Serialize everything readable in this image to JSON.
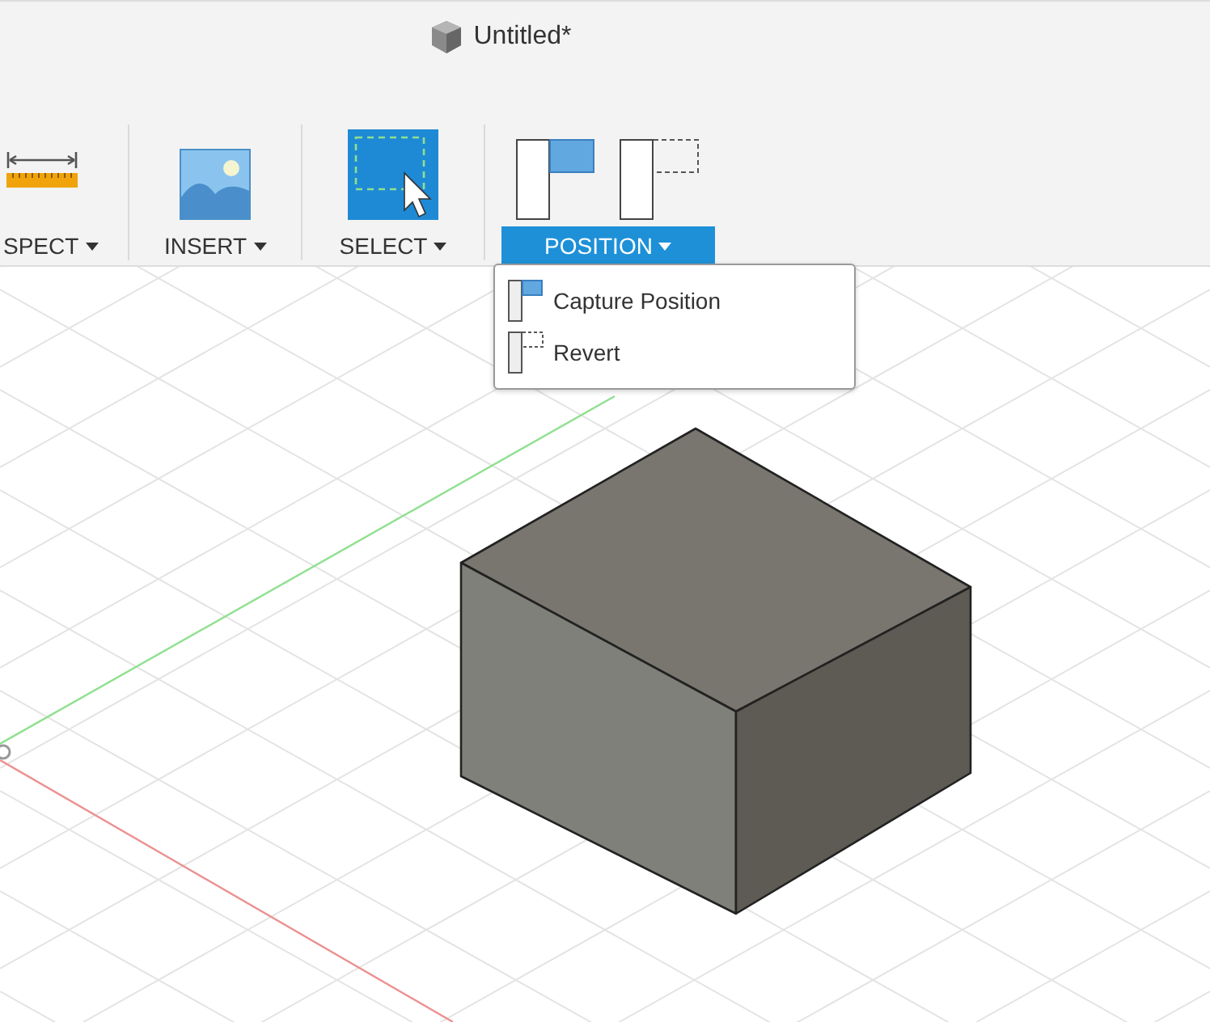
{
  "window": {
    "title": "Untitled*"
  },
  "toolbar": {
    "groups": [
      {
        "label": "SPECT",
        "kind": "inspect",
        "selected": false
      },
      {
        "label": "INSERT",
        "kind": "insert",
        "selected": false
      },
      {
        "label": "SELECT",
        "kind": "select",
        "selected": false
      },
      {
        "label": "POSITION",
        "kind": "position",
        "selected": true
      }
    ]
  },
  "dropdown": {
    "items": [
      {
        "label": "Capture Position",
        "kind": "capture"
      },
      {
        "label": "Revert",
        "kind": "revert"
      }
    ]
  }
}
